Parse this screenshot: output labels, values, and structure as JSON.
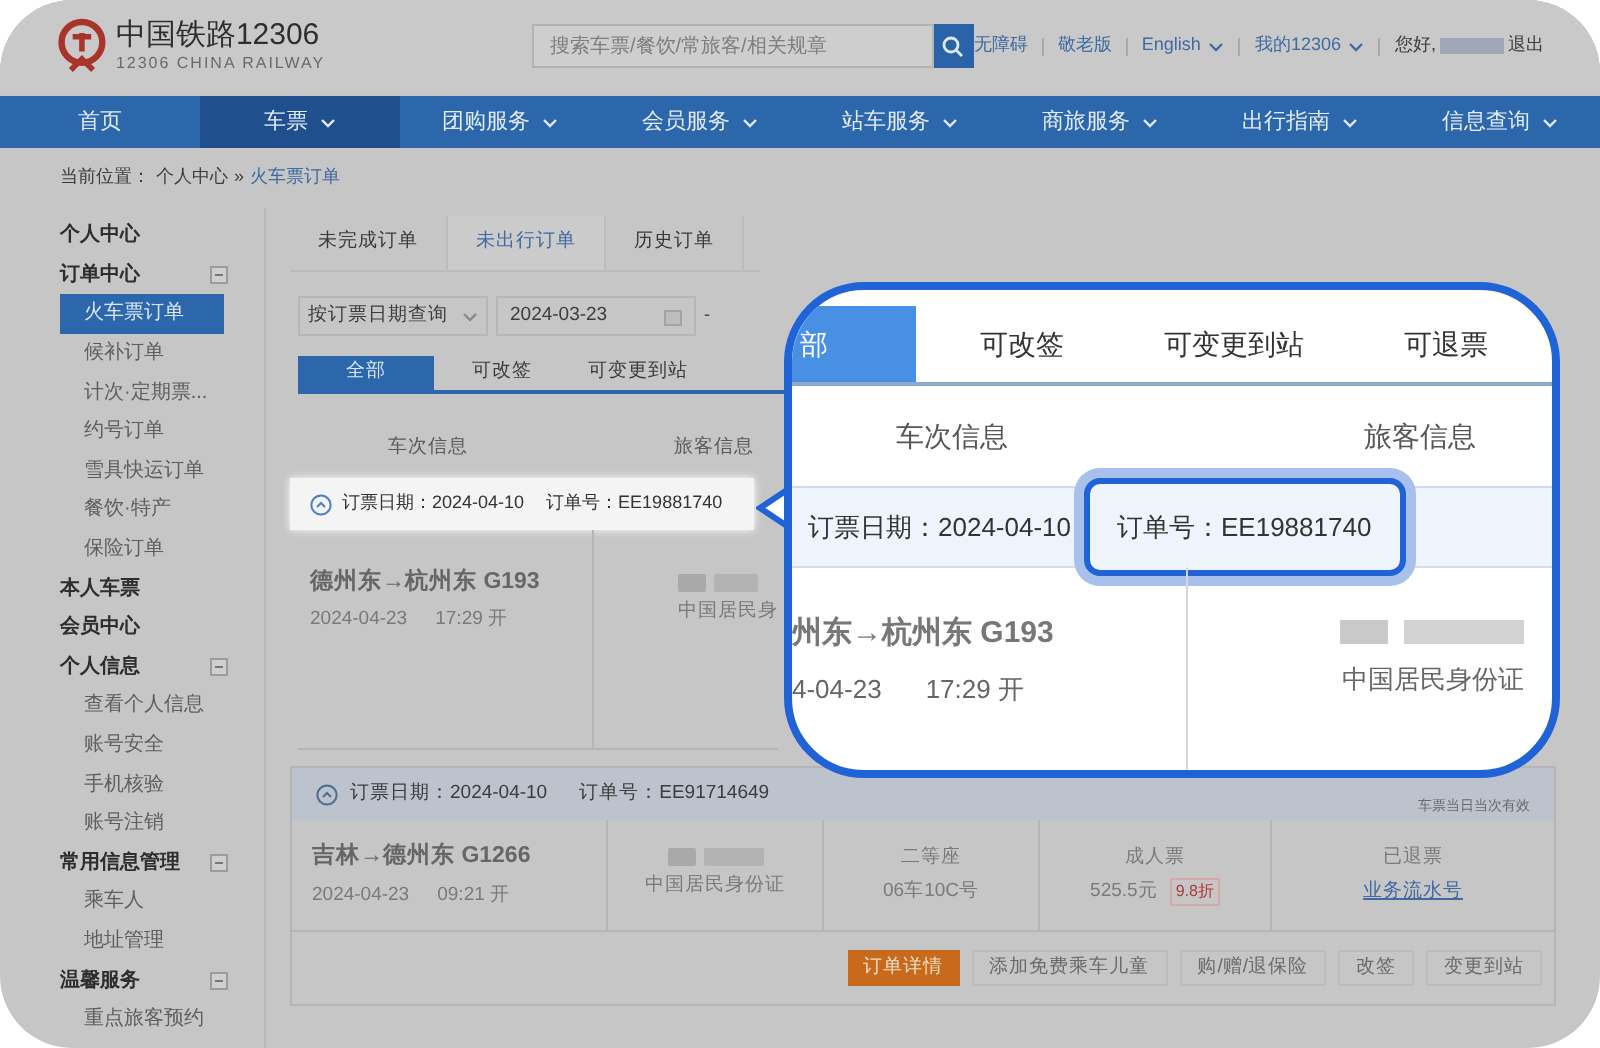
{
  "header": {
    "logo_title": "中国铁路12306",
    "logo_subtitle": "12306 CHINA RAILWAY",
    "search": {
      "placeholder": "搜索车票/餐饮/常旅客/相关规章"
    },
    "links": [
      {
        "label": "无障碍",
        "dropdown": false
      },
      {
        "label": "敬老版",
        "dropdown": false
      },
      {
        "label": "English",
        "dropdown": true
      },
      {
        "label": "我的12306",
        "dropdown": true
      }
    ],
    "greeting": "您好,",
    "logout": "退出"
  },
  "nav": [
    {
      "label": "首页",
      "selected": false,
      "dropdown": false
    },
    {
      "label": "车票",
      "selected": true,
      "dropdown": true
    },
    {
      "label": "团购服务",
      "selected": false,
      "dropdown": true
    },
    {
      "label": "会员服务",
      "selected": false,
      "dropdown": true
    },
    {
      "label": "站车服务",
      "selected": false,
      "dropdown": true
    },
    {
      "label": "商旅服务",
      "selected": false,
      "dropdown": true
    },
    {
      "label": "出行指南",
      "selected": false,
      "dropdown": true
    },
    {
      "label": "信息查询",
      "selected": false,
      "dropdown": true
    }
  ],
  "breadcrumb": {
    "label": "当前位置：",
    "path": [
      "个人中心",
      "火车票订单"
    ],
    "separator": "»"
  },
  "sidebar": [
    {
      "label": "个人中心",
      "collapsible": false
    },
    {
      "label": "订单中心",
      "collapsible": true,
      "items": [
        {
          "label": "火车票订单",
          "selected": true
        },
        {
          "label": "候补订单",
          "selected": false
        },
        {
          "label": "计次·定期票...",
          "selected": false
        },
        {
          "label": "约号订单",
          "selected": false
        },
        {
          "label": "雪具快运订单",
          "selected": false
        },
        {
          "label": "餐饮·特产",
          "selected": false
        },
        {
          "label": "保险订单",
          "selected": false
        }
      ]
    },
    {
      "label": "本人车票",
      "collapsible": false
    },
    {
      "label": "会员中心",
      "collapsible": false
    },
    {
      "label": "个人信息",
      "collapsible": true,
      "items": [
        {
          "label": "查看个人信息",
          "selected": false
        },
        {
          "label": "账号安全",
          "selected": false
        },
        {
          "label": "手机核验",
          "selected": false
        },
        {
          "label": "账号注销",
          "selected": false
        }
      ]
    },
    {
      "label": "常用信息管理",
      "collapsible": true,
      "items": [
        {
          "label": "乘车人",
          "selected": false
        },
        {
          "label": "地址管理",
          "selected": false
        }
      ]
    },
    {
      "label": "温馨服务",
      "collapsible": true,
      "items": [
        {
          "label": "重点旅客预约",
          "selected": false
        }
      ]
    }
  ],
  "order_tabs": [
    {
      "label": "未完成订单",
      "selected": false
    },
    {
      "label": "未出行订单",
      "selected": true
    },
    {
      "label": "历史订单",
      "selected": false
    }
  ],
  "filter": {
    "query_type": "按订票日期查询",
    "start_date": "2024-03-23",
    "separator": "-"
  },
  "status_tabs": [
    {
      "label": "全部",
      "selected": true
    },
    {
      "label": "可改签",
      "selected": false
    },
    {
      "label": "可变更到站",
      "selected": false
    }
  ],
  "columns": [
    "车次信息",
    "旅客信息"
  ],
  "orders": [
    {
      "highlighted": true,
      "booking_date": "订票日期：2024-04-10",
      "order_no": "订单号：EE19881740",
      "route": "德州东→杭州东 G193",
      "date": "2024-04-23",
      "departure": "17:29 开",
      "id_type": "中国居民身"
    },
    {
      "highlighted": false,
      "booking_date": "订票日期：2024-04-10",
      "order_no": "订单号：EE91714649",
      "route": "吉林→德州东 G1266",
      "date": "2024-04-23",
      "departure": "09:21 开",
      "id_type": "中国居民身份证",
      "notice": "车票当日当次有效",
      "seat": {
        "class": "二等座",
        "place": "06车10C号"
      },
      "ticket": {
        "type": "成人票",
        "price": "525.5元",
        "discount": "9.8折"
      },
      "status": {
        "label": "已退票",
        "link": "业务流水号"
      }
    }
  ],
  "actions": [
    {
      "label": "订单详情",
      "primary": true
    },
    {
      "label": "添加免费乘车儿童",
      "primary": false
    },
    {
      "label": "购/赠/退保险",
      "primary": false
    },
    {
      "label": "改签",
      "primary": false
    },
    {
      "label": "变更到站",
      "primary": false
    }
  ],
  "callout": {
    "tabs": [
      {
        "label": "部",
        "selected": true
      },
      {
        "label": "可改签",
        "selected": false
      },
      {
        "label": "可变更到站",
        "selected": false
      },
      {
        "label": "可退票",
        "selected": false
      }
    ],
    "columns": [
      "车次信息",
      "旅客信息"
    ],
    "booking_date": "订票日期：2024-04-10",
    "order_no": "订单号：EE19881740",
    "route": "州东→杭州东 G193",
    "date": "4-04-23",
    "departure": "17:29 开",
    "id_type": "中国居民身份证"
  }
}
